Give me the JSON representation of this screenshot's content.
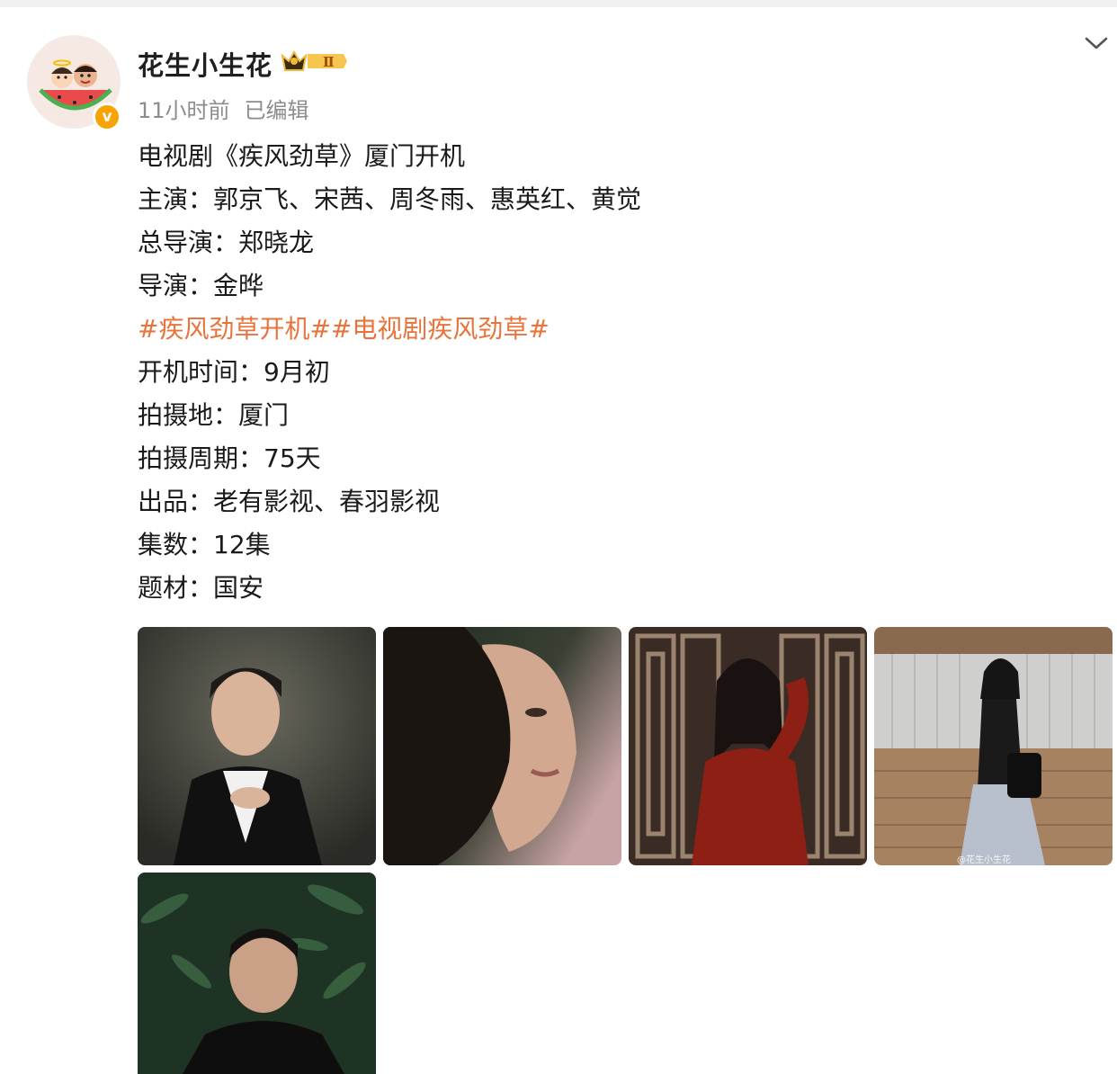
{
  "post": {
    "author": "花生小生花",
    "time": "11小时前",
    "edited": "已编辑",
    "verified_mark": "v",
    "level_badge": "Ⅱ",
    "lines": [
      "电视剧《疾风劲草》厦门开机",
      "主演：郭京飞、宋茜、周冬雨、惠英红、黄觉",
      "总导演：郑晓龙",
      "导演：金晔",
      "#疾风劲草开机##电视剧疾风劲草#",
      "开机时间：9月初",
      "拍摄地：厦门",
      "拍摄周期：75天",
      "出品：老有影视、春羽影视",
      "集数：12集",
      "题材：国安"
    ],
    "photo_watermark": "@花生小生花"
  },
  "icons": {
    "avatar": "cartoon-avatar-icon",
    "verified": "verified-badge-icon",
    "level": "crown-level-icon",
    "menu": "chevron-down-icon"
  },
  "colors": {
    "topic": "#e8743b",
    "verified": "#f7a300",
    "meta": "#8c8c8c"
  }
}
